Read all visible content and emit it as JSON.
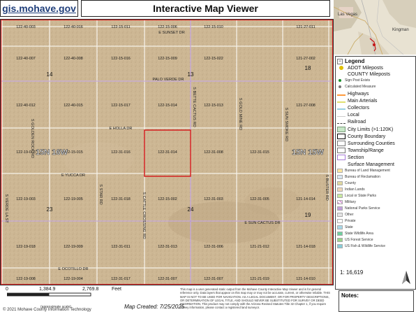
{
  "header": {
    "logo_text": "gis.mohave.gov",
    "title": "Interactive Map Viewer"
  },
  "map": {
    "parcels": [
      [
        "122-40-003",
        "122-40-016",
        "122-15-011",
        "122-15-006",
        "122-15-010",
        "121-27-011"
      ],
      [
        "122-40-007",
        "122-40-008",
        "122-15-016",
        "122-15-009",
        "122-15-022",
        "121-27-002"
      ],
      [
        "122-40-012",
        "122-40-015",
        "122-15-017",
        "122-15-014",
        "122-15-013",
        "121-27-008"
      ],
      [
        "122-19-003",
        "122-15-015",
        "122-31-016",
        "122-31-014",
        "122-31-008",
        "122-31-015"
      ],
      [
        "122-19-003",
        "122-19-005",
        "122-31-018",
        "122-15-002",
        "122-31-003",
        "122-31-005"
      ],
      [
        "122-19-018",
        "122-19-009",
        "122-31-011",
        "122-31-013",
        "122-31-006",
        "121-21-012"
      ],
      [
        "122-19-008",
        "122-19-004",
        "122-31-017",
        "122-31-007",
        "122-31-007",
        "121-21-019"
      ]
    ],
    "extra_parcels": [
      "121-14-014",
      "121-14-018",
      "121-14-010"
    ],
    "section_numbers": [
      "14",
      "13",
      "18",
      "23",
      "24",
      "19"
    ],
    "roads": {
      "sunset": "E SUNSET DR",
      "palo_verde": "PALO VERDE DR",
      "holla": "E HOLLA DR",
      "eyucca": "E YUCCA DR",
      "sun_cactus": "E SUN CACTUS DR",
      "ocotillo": "E OCOTILLO DR",
      "golden_rock": "S GOLDEN ROCK RD",
      "cactus": "S BETTE CACTUS RD",
      "gold_mine": "S GOLD MINE RD",
      "sun_smoke": "S SUN SMOKE RD",
      "star": "S STAR RD",
      "cattle": "S CATTLE CROSSING RD",
      "verde": "S VERDE LA ST",
      "right_edge": "S BUSTER RD"
    },
    "township_labels": [
      "15N 16W",
      "15N 15W"
    ],
    "inset_labels": [
      "Las Vegas",
      "Kingman"
    ]
  },
  "legend": {
    "title": "Legend",
    "items": [
      {
        "label": "ADOT Mileposts",
        "type": "header"
      },
      {
        "label": "COUNTY Mileposts",
        "type": "header"
      },
      {
        "label": "Sign Post Exists",
        "type": "sub"
      },
      {
        "label": "Calculated Measure",
        "type": "sub"
      },
      {
        "label": "Highways",
        "type": "line"
      },
      {
        "label": "Main Arterials",
        "type": "line"
      },
      {
        "label": "Collectors",
        "type": "line"
      },
      {
        "label": "Local",
        "type": "line"
      },
      {
        "label": "Railroad",
        "type": "line"
      },
      {
        "label": "City Limits (>1:120K)",
        "type": "box"
      },
      {
        "label": "County Boundary",
        "type": "box"
      },
      {
        "label": "Surrounding Counties",
        "type": "box"
      },
      {
        "label": "Township/Range",
        "type": "box"
      },
      {
        "label": "Section",
        "type": "box"
      },
      {
        "label": "Surface Management",
        "type": "header"
      },
      {
        "label": "Bureau of Land Management",
        "type": "sub"
      },
      {
        "label": "Bureau of Reclamation",
        "type": "sub"
      },
      {
        "label": "County",
        "type": "sub"
      },
      {
        "label": "Indian Lands",
        "type": "sub"
      },
      {
        "label": "Local or State Parks",
        "type": "sub"
      },
      {
        "label": "Military",
        "type": "sub"
      },
      {
        "label": "National Parks Service",
        "type": "sub"
      },
      {
        "label": "Other",
        "type": "sub"
      },
      {
        "label": "Private",
        "type": "sub"
      },
      {
        "label": "State",
        "type": "sub"
      },
      {
        "label": "State Wildlife Area",
        "type": "sub"
      },
      {
        "label": "US Forest Service",
        "type": "sub"
      },
      {
        "label": "US Fish & Wildlife Service",
        "type": "sub"
      }
    ],
    "scale_ratio": "1: 16,619"
  },
  "colors": {
    "adot": "#e0c000",
    "county_mp": "#1a8f2a",
    "calc": "#777777",
    "highways": "#ff9a3c",
    "main": "#e0e070",
    "collectors": "#9ad0e0",
    "local": "#cccccc",
    "railroad": "#444444",
    "city": "#c8e8c8",
    "county_b": "#000000",
    "surrounding": "#ffffff",
    "township": "#ffffff",
    "section": "#ffffff",
    "blm": "#fde7a0",
    "bor": "#d9e7f3",
    "county": "#e0d8a0",
    "indian": "#f0d8b8",
    "parks": "#c8eaa0",
    "military": "#d89ad8",
    "nps": "#c2a0dc",
    "other": "#e4e4e4",
    "private": "#ffffff",
    "state": "#a8d8e8",
    "wildlife": "#6fcf9f",
    "usfs": "#9bd48a",
    "fws": "#88ccd8"
  },
  "footer": {
    "notes": "Notes:",
    "scale_labels": [
      "0",
      "1,384.9",
      "2,769.8",
      "Feet"
    ],
    "approx": "(approximate scale)",
    "created": "Map Created: 7/25/2025",
    "copyright": "© 2021 Mohave County Information Technology",
    "disclaimer": "This map is a user generated static output from the Mohave County Interactive Map Viewer and is for general reference only. Data layers that appear on this map may or may not be accurate, current, or otherwise reliable. THIS MAP IS NOT TO BE USED FOR NAVIGATION. AS A LEGAL DOCUMENT, OR FOR PROPERTY DESCRIPTIONS, OR DETERMINATION OF LEGAL TITLE, AND SHOULD NEVER BE SUBSTITUTED FOR SURVEY OR DEED INFORMATION. This product may not comply with the Arizona Revised Statutes Title 32 Chapter 1, if you require survey information, please contact a registered land surveyor."
  }
}
